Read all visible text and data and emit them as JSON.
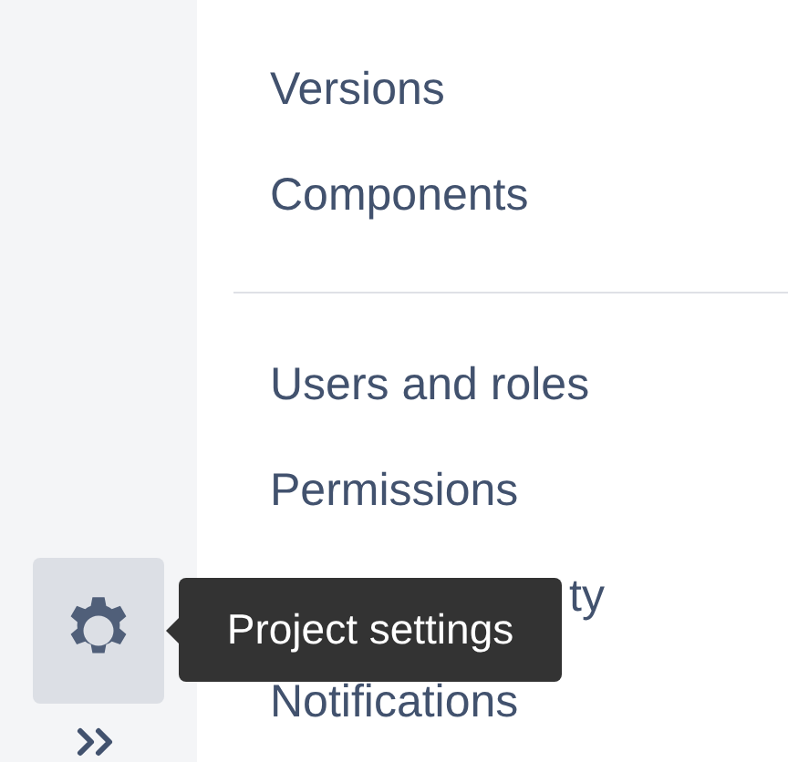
{
  "sidebar": {
    "settings_button": {
      "tooltip": "Project settings"
    }
  },
  "menu": {
    "groups": [
      {
        "items": [
          {
            "label": "Versions",
            "kind": "full"
          },
          {
            "label": "Components",
            "kind": "full"
          }
        ]
      },
      {
        "items": [
          {
            "label": "Users and roles",
            "kind": "full"
          },
          {
            "label": "Permissions",
            "kind": "full"
          },
          {
            "label": "ty",
            "kind": "partly_hidden"
          },
          {
            "label": "Notifications",
            "kind": "full"
          }
        ]
      }
    ]
  }
}
